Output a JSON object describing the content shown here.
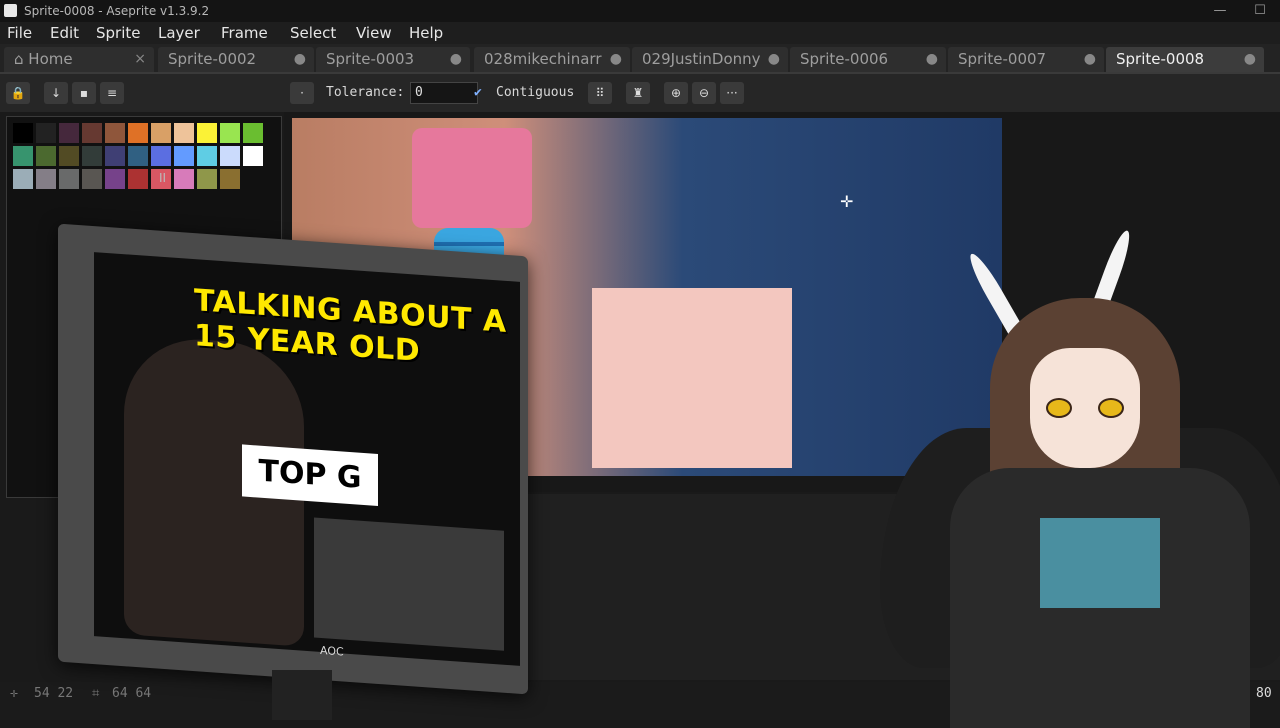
{
  "window": {
    "title": "Sprite-0008 - Aseprite v1.3.9.2"
  },
  "menu": [
    "File",
    "Edit",
    "Sprite",
    "Layer",
    "Frame",
    "Select",
    "View",
    "Help"
  ],
  "tabs": [
    {
      "label": "Home",
      "close": "×"
    },
    {
      "label": "Sprite-0002",
      "close": "●"
    },
    {
      "label": "Sprite-0003",
      "close": "●"
    },
    {
      "label": "028mikechinarr",
      "close": "●"
    },
    {
      "label": "029JustinDonny",
      "close": "●"
    },
    {
      "label": "Sprite-0006",
      "close": "●"
    },
    {
      "label": "Sprite-0007",
      "close": "●"
    },
    {
      "label": "Sprite-0008",
      "close": "●"
    }
  ],
  "toolbar": {
    "tolerance_label": "Tolerance:",
    "tolerance_value": "0",
    "contiguous_label": "Contiguous",
    "contiguous_check": "✔",
    "more": "···"
  },
  "palette": {
    "colors": [
      "#000000",
      "#222222",
      "#45283c",
      "#663931",
      "#8f563b",
      "#df7126",
      "#d9a066",
      "#eec39a",
      "#fbf236",
      "#99e550",
      "#6abe30",
      "#37946e",
      "#4b692f",
      "#524b24",
      "#323c39",
      "#3f3f74",
      "#306082",
      "#5b6ee1",
      "#639bff",
      "#5fcde4",
      "#cbdbfc",
      "#ffffff",
      "#9badb7",
      "#847e87",
      "#696a6a",
      "#595652",
      "#76428a",
      "#ac3232",
      "#d95763",
      "#d77bba",
      "#8f974a",
      "#8a6f30"
    ],
    "indicator": "II"
  },
  "overlay": {
    "caption": "TALKING ABOUT A 15 YEAR OLD",
    "badge": "TOP G",
    "monitor_brand": "AOC"
  },
  "status": {
    "position": "54 22",
    "size": "64 64",
    "zoom": "80",
    "plus": "+"
  }
}
